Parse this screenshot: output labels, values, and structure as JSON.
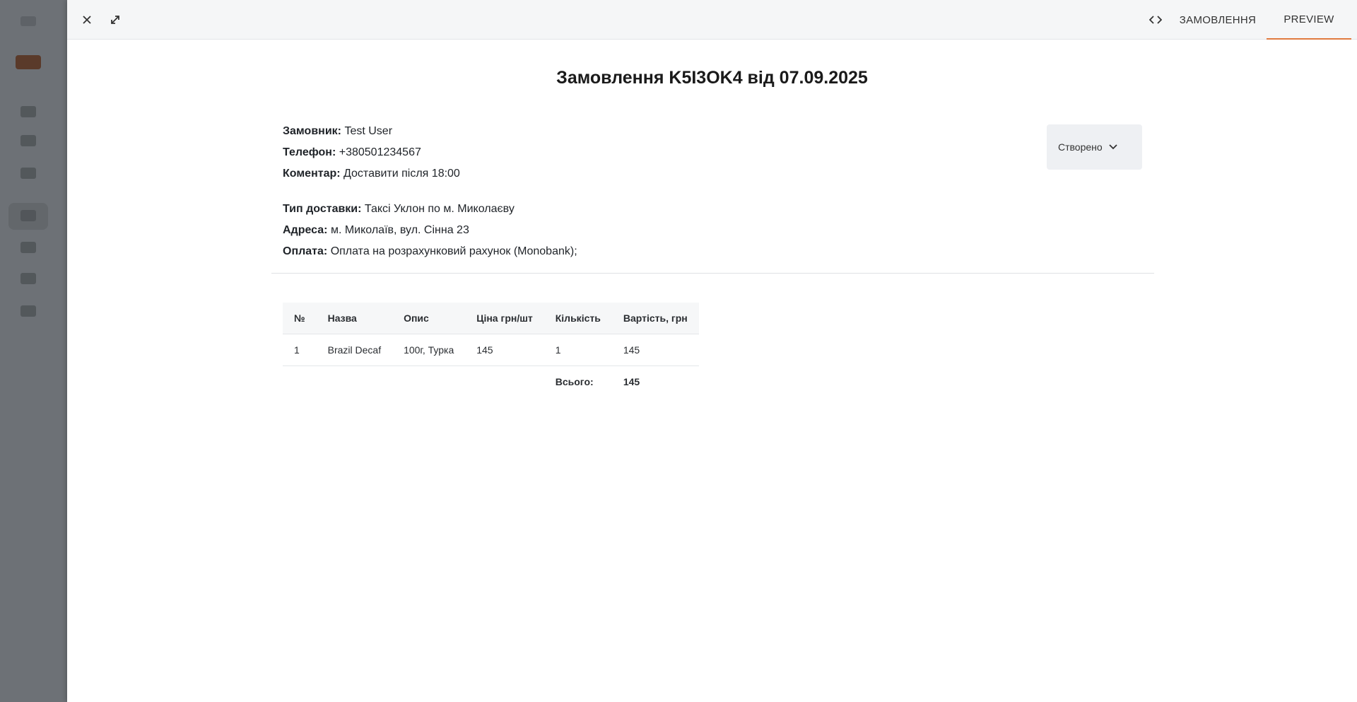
{
  "toolbar": {
    "tabs": [
      {
        "label": "ЗАМОВЛЕННЯ"
      },
      {
        "label": "PREVIEW"
      }
    ]
  },
  "order": {
    "title": "Замовлення K5I3OK4 від 07.09.2025",
    "customer": {
      "label": "Замовник:",
      "value": "Test User"
    },
    "phone": {
      "label": "Телефон:",
      "value": "+380501234567"
    },
    "comment": {
      "label": "Коментар:",
      "value": "Доставити після 18:00"
    },
    "delivery": {
      "label": "Тип доставки:",
      "value": "Таксі Уклон по м. Миколаєву"
    },
    "address": {
      "label": "Адреса:",
      "value": "м. Миколаїв, вул. Сінна 23"
    },
    "payment": {
      "label": "Оплата:",
      "value": "Оплата на розрахунковий рахунок (Monobank);"
    },
    "status": "Створено"
  },
  "items_table": {
    "headers": [
      "№",
      "Назва",
      "Опис",
      "Ціна грн/шт",
      "Кількість",
      "Вартість, грн"
    ],
    "rows": [
      [
        "1",
        "Brazil Decaf",
        "100г, Турка",
        "145",
        "1",
        "145"
      ]
    ],
    "total_label": "Всього:",
    "total_value": "145"
  },
  "icons": {
    "close": "close-icon",
    "expand": "expand-icon",
    "code": "code-icon",
    "chevron": "chevron-down-icon"
  },
  "colors": {
    "accent": "#e07a3f"
  }
}
